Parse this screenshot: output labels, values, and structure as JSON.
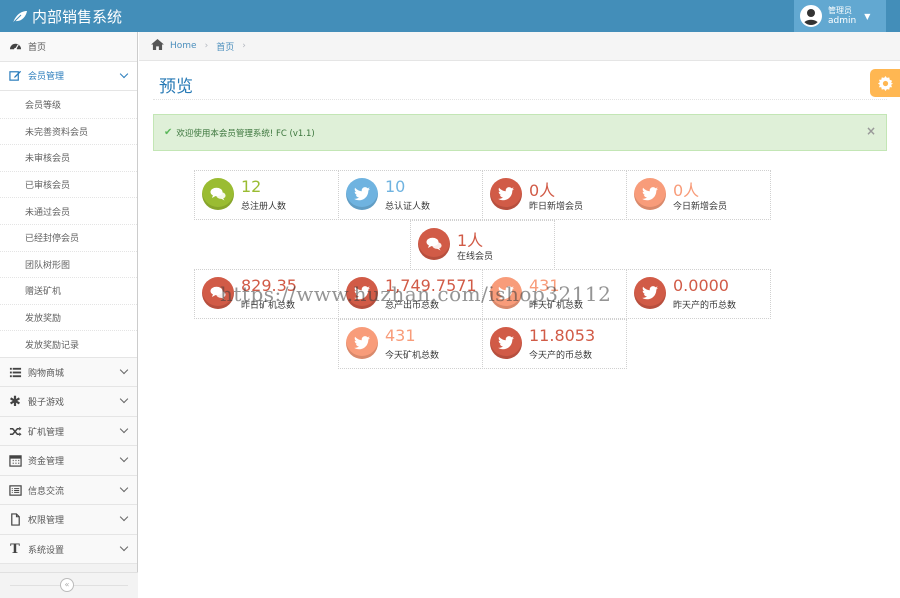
{
  "app": {
    "title": "内部销售系统"
  },
  "user": {
    "role": "管理员",
    "name": "admin"
  },
  "sidebar": {
    "items": [
      {
        "label": "首页",
        "icon": "tachometer-icon"
      },
      {
        "label": "会员管理",
        "icon": "edit-icon",
        "open": true,
        "children": [
          "会员等级",
          "未完善资料会员",
          "未审核会员",
          "已审核会员",
          "未通过会员",
          "已经封停会员",
          "团队树形图",
          "赠送矿机",
          "发放奖励",
          "发放奖励记录"
        ]
      },
      {
        "label": "购物商城",
        "icon": "list-icon"
      },
      {
        "label": "骰子游戏",
        "icon": "asterisk-icon"
      },
      {
        "label": "矿机管理",
        "icon": "random-icon"
      },
      {
        "label": "资金管理",
        "icon": "calendar-icon"
      },
      {
        "label": "信息交流",
        "icon": "list-alt-icon"
      },
      {
        "label": "权限管理",
        "icon": "file-icon"
      },
      {
        "label": "系统设置",
        "icon": "text-icon"
      }
    ],
    "collapse_glyph": "«"
  },
  "breadcrumb": {
    "home": "Home",
    "current": "首页",
    "sep": "›"
  },
  "page": {
    "title": "预览"
  },
  "alert": {
    "text": "欢迎使用本会员管理系统! FC (v1.1)",
    "close": "×"
  },
  "stats": [
    {
      "value": "12",
      "label": "总注册人数",
      "color": "green",
      "icon": "comments-icon"
    },
    {
      "value": "10",
      "label": "总认证人数",
      "color": "blue",
      "icon": "twitter-icon"
    },
    {
      "value": "0人",
      "label": "昨日新增会员",
      "color": "red",
      "icon": "twitter-icon"
    },
    {
      "value": "0人",
      "label": "今日新增会员",
      "color": "pink",
      "icon": "twitter-icon"
    },
    {
      "value": "1人",
      "label": "在线会员",
      "color": "red",
      "icon": "comments-icon"
    },
    {
      "value": "829.35",
      "label": "昨日矿机总数",
      "color": "red",
      "icon": "comments-icon"
    },
    {
      "value": "1,749.7571",
      "label": "总产出币总数",
      "color": "red",
      "icon": "twitter-icon"
    },
    {
      "value": "431",
      "label": "昨天矿机总数",
      "color": "pink",
      "icon": "twitter-icon"
    },
    {
      "value": "0.0000",
      "label": "昨天产的币总数",
      "color": "red",
      "icon": "twitter-icon"
    },
    {
      "value": "431",
      "label": "今天矿机总数",
      "color": "pink",
      "icon": "twitter-icon"
    },
    {
      "value": "11.8053",
      "label": "今天产的币总数",
      "color": "red",
      "icon": "twitter-icon"
    }
  ],
  "watermark": "https://www.huzhan.com/ishop32112"
}
